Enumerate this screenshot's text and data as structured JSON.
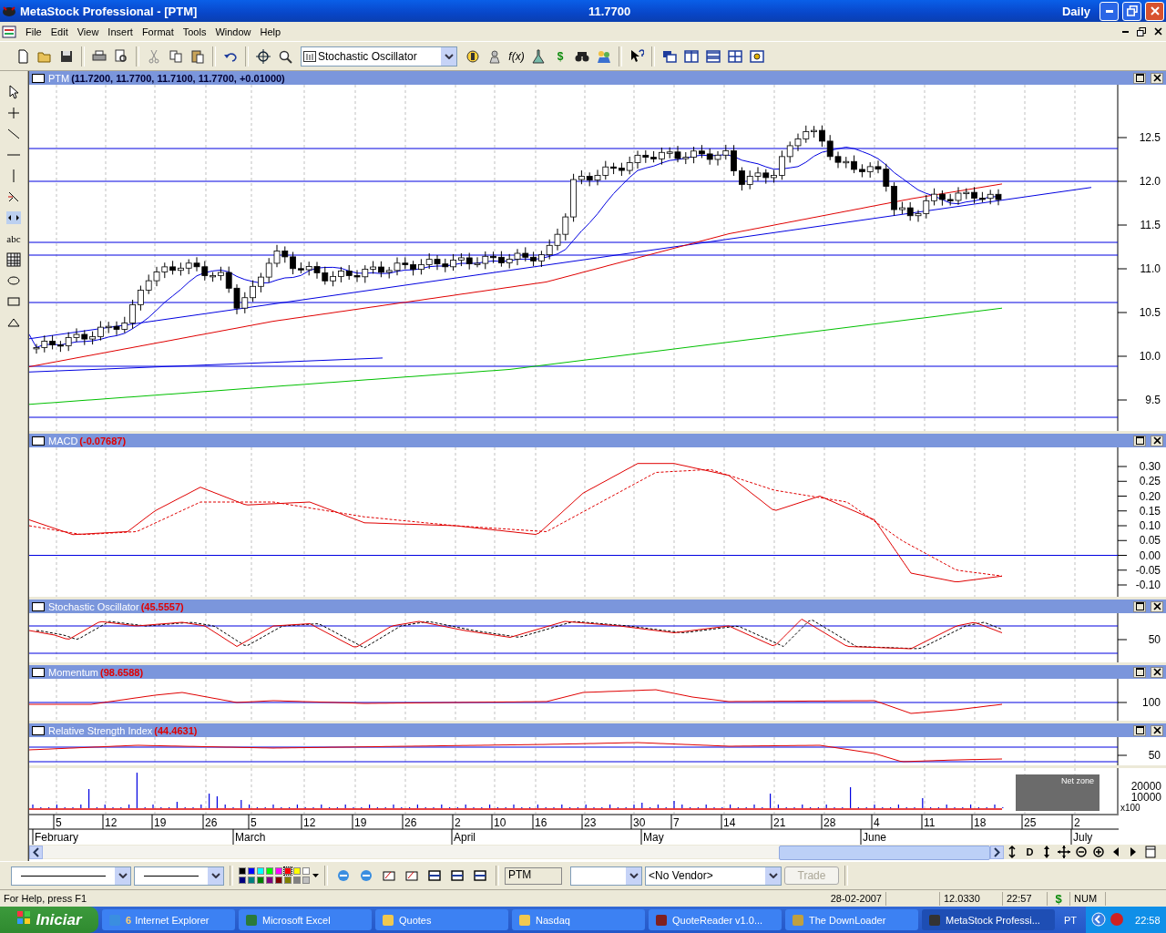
{
  "window": {
    "title": "MetaStock Professional - [PTM]",
    "price": "11.7700",
    "periodicity": "Daily"
  },
  "menu": [
    "File",
    "Edit",
    "View",
    "Insert",
    "Format",
    "Tools",
    "Window",
    "Help"
  ],
  "toolbar": {
    "indicator_select": "Stochastic Oscillator",
    "formula_label": "f(x)",
    "dollar_label": "$"
  },
  "tool_palette": {
    "text_tool": "abc"
  },
  "panels": [
    {
      "kind": "price",
      "name": "PTM",
      "value": "(11.7200, 11.7700, 11.7100, 11.7700, +0.01000)",
      "axis_labels": [
        "12.5",
        "12.0",
        "11.5",
        "11.0",
        "10.5",
        "10.0",
        "9.5"
      ]
    },
    {
      "kind": "macd",
      "name": "MACD",
      "value": "(-0.07687)",
      "axis_labels": [
        "0.30",
        "0.25",
        "0.20",
        "0.15",
        "0.10",
        "0.05",
        "0.00",
        "-0.05",
        "-0.10"
      ]
    },
    {
      "kind": "stochastic",
      "name": "Stochastic Oscillator",
      "value": "(45.5557)",
      "axis_labels": [
        "50"
      ]
    },
    {
      "kind": "momentum",
      "name": "Momentum",
      "value": "(98.6588)",
      "axis_labels": [
        "100"
      ]
    },
    {
      "kind": "rsi",
      "name": "Relative Strength Index",
      "value": "(44.4631)",
      "axis_labels": [
        "50"
      ]
    }
  ],
  "volume": {
    "axis_labels": [
      "20000",
      "10000"
    ],
    "multiplier": "x100",
    "net_zone": "Net zone"
  },
  "date_axis": {
    "days": [
      "5",
      "12",
      "19",
      "26",
      "5",
      "12",
      "19",
      "26",
      "2",
      "10",
      "16",
      "23",
      "30",
      "7",
      "14",
      "21",
      "28",
      "4",
      "11",
      "18",
      "25",
      "2"
    ],
    "months": [
      "February",
      "March",
      "April",
      "May",
      "June",
      "July"
    ]
  },
  "scroll_nav": {
    "daily_label": "D"
  },
  "format_toolbar": {
    "palette": [
      {
        "color": "#000000",
        "selected": false
      },
      {
        "color": "#0000ff",
        "selected": false
      },
      {
        "color": "#00ffff",
        "selected": false
      },
      {
        "color": "#00ff00",
        "selected": false
      },
      {
        "color": "#ff00ff",
        "selected": false
      },
      {
        "color": "#ff0000",
        "selected": true
      },
      {
        "color": "#ffff00",
        "selected": false
      },
      {
        "color": "#ffffff",
        "selected": false
      },
      {
        "color": "#000080",
        "selected": false
      },
      {
        "color": "#008080",
        "selected": false
      },
      {
        "color": "#008000",
        "selected": false
      },
      {
        "color": "#800080",
        "selected": false
      },
      {
        "color": "#800000",
        "selected": false
      },
      {
        "color": "#808000",
        "selected": false
      },
      {
        "color": "#808080",
        "selected": false
      },
      {
        "color": "#c0c0c0",
        "selected": false
      }
    ],
    "symbol": "PTM",
    "vendor": "<No Vendor>",
    "trade_button": {
      "label": "Trade",
      "disabled": true
    }
  },
  "status_bar": {
    "help": "For Help, press F1",
    "date": "28-02-2007",
    "value": "12.0330",
    "time": "22:57",
    "currency": "$",
    "num": "NUM"
  },
  "taskbar": {
    "start": "Iniciar",
    "items": [
      {
        "count": "6",
        "label": "Internet Explorer",
        "selected": false
      },
      {
        "label": "Microsoft Excel",
        "selected": false
      },
      {
        "label": "Quotes",
        "selected": false
      },
      {
        "label": "Nasdaq",
        "selected": false
      },
      {
        "label": "QuoteReader v1.0...",
        "selected": false
      },
      {
        "label": "The DownLoader",
        "selected": false
      },
      {
        "label": "MetaStock Professi...",
        "selected": true
      }
    ],
    "language": "PT",
    "clock": "22:58"
  }
}
